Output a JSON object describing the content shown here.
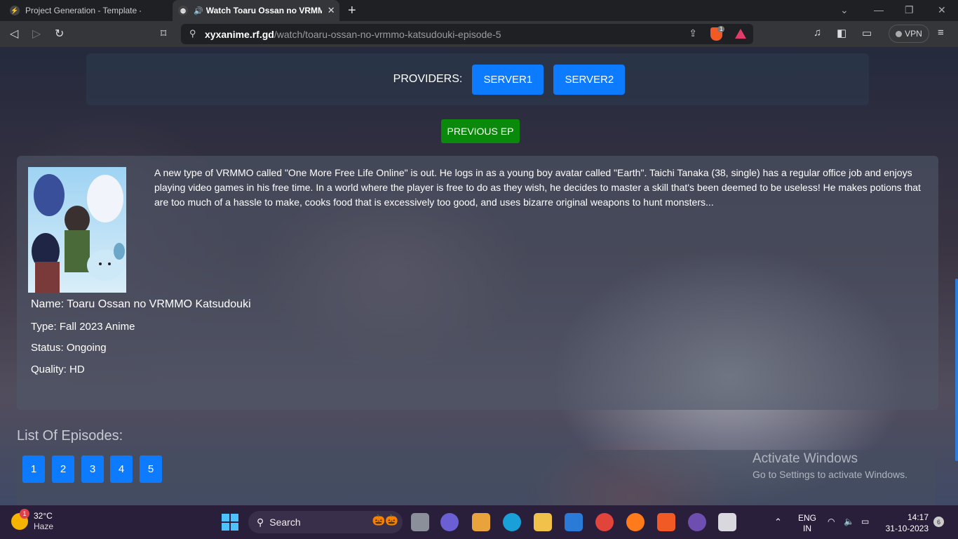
{
  "browser": {
    "tabs": [
      {
        "title": "Project Generation - Template - FastAPI",
        "active": false
      },
      {
        "title": "Watch Toaru Ossan no VRMMO Katsudouki",
        "active": true
      }
    ],
    "url_host": "xyxanime.rf.gd",
    "url_path": "/watch/toaru-ossan-no-vrmmo-katsudouki-episode-5",
    "shield_count": "1",
    "vpn_label": "VPN"
  },
  "providers": {
    "label": "PROVIDERS:",
    "servers": [
      "SERVER1",
      "SERVER2"
    ]
  },
  "previous_ep_label": "PREVIOUS EP",
  "anime": {
    "synopsis": "A new type of VRMMO called \"One More Free Life Online\" is out. He logs in as a young boy avatar called \"Earth\". Taichi Tanaka (38, single) has a regular office job and enjoys playing video games in his free time. In a world where the player is free to do as they wish, he decides to master a skill that's been deemed to be useless! He makes potions that are too much of a hassle to make, cooks food that is excessively too good, and uses bizarre original weapons to hunt monsters...",
    "name": "Name: Toaru Ossan no VRMMO Katsudouki",
    "type": "Type: Fall 2023 Anime",
    "status": "Status: Ongoing",
    "quality": "Quality: HD"
  },
  "episodes": {
    "title": "List Of Episodes:",
    "items": [
      "1",
      "2",
      "3",
      "4",
      "5"
    ]
  },
  "watermark": {
    "line1": "Activate Windows",
    "line2": "Go to Settings to activate Windows."
  },
  "taskbar": {
    "temp": "32°C",
    "condition": "Haze",
    "weather_badge": "1",
    "search_label": "Search",
    "lang1": "ENG",
    "lang2": "IN",
    "time": "14:17",
    "date": "31-10-2023",
    "notifications": "6"
  },
  "colors": {
    "server_button": "#0d7bff",
    "prev_ep_button": "#0a8a0a",
    "taskbar": "#2a1f3a"
  }
}
